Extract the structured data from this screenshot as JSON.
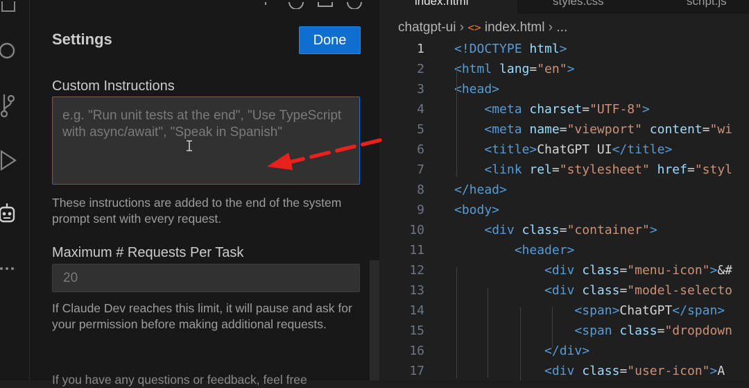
{
  "settings": {
    "title": "Settings",
    "done_label": "Done",
    "custom_instructions": {
      "label": "Custom Instructions",
      "placeholder": "e.g. \"Run unit tests at the end\", \"Use TypeScript with async/await\", \"Speak in Spanish\"",
      "help": "These instructions are added to the end of the system prompt sent with every request."
    },
    "max_requests": {
      "label": "Maximum # Requests Per Task",
      "placeholder": "20",
      "help": "If Claude Dev reaches this limit, it will pause and ask for your permission before making additional requests."
    },
    "footer_text": "If you have any questions or feedback, feel free"
  },
  "editor": {
    "tabs": [
      "index.html",
      "styles.css",
      "script.js"
    ],
    "breadcrumb": {
      "folder": "chatgpt-ui",
      "file": "index.html",
      "more": "..."
    },
    "active_line": 1,
    "lines": [
      {
        "n": "1",
        "tokens": [
          [
            "t-tag",
            "<!DOCTYPE"
          ],
          [
            "t-attr",
            " html"
          ],
          [
            "t-tag",
            ">"
          ]
        ]
      },
      {
        "n": "2",
        "tokens": [
          [
            "t-tag",
            "<html"
          ],
          [
            "t-attr",
            " lang"
          ],
          [
            "t-txt",
            "="
          ],
          [
            "t-str",
            "\"en\""
          ],
          [
            "t-tag",
            ">"
          ]
        ]
      },
      {
        "n": "3",
        "tokens": [
          [
            "t-tag",
            "<head>"
          ]
        ]
      },
      {
        "n": "4",
        "tokens": [
          [
            "t-txt",
            "    "
          ],
          [
            "t-tag",
            "<meta"
          ],
          [
            "t-attr",
            " charset"
          ],
          [
            "t-txt",
            "="
          ],
          [
            "t-str",
            "\"UTF-8\""
          ],
          [
            "t-tag",
            ">"
          ]
        ]
      },
      {
        "n": "5",
        "tokens": [
          [
            "t-txt",
            "    "
          ],
          [
            "t-tag",
            "<meta"
          ],
          [
            "t-attr",
            " name"
          ],
          [
            "t-txt",
            "="
          ],
          [
            "t-str",
            "\"viewport\""
          ],
          [
            "t-attr",
            " content"
          ],
          [
            "t-txt",
            "="
          ],
          [
            "t-str",
            "\"wi"
          ]
        ]
      },
      {
        "n": "6",
        "tokens": [
          [
            "t-txt",
            "    "
          ],
          [
            "t-tag",
            "<title>"
          ],
          [
            "t-txt",
            "ChatGPT UI"
          ],
          [
            "t-tag",
            "</title>"
          ]
        ]
      },
      {
        "n": "7",
        "tokens": [
          [
            "t-txt",
            "    "
          ],
          [
            "t-tag",
            "<link"
          ],
          [
            "t-attr",
            " rel"
          ],
          [
            "t-txt",
            "="
          ],
          [
            "t-str",
            "\"stylesheet\""
          ],
          [
            "t-attr",
            " href"
          ],
          [
            "t-txt",
            "="
          ],
          [
            "t-str",
            "\"styl"
          ]
        ]
      },
      {
        "n": "8",
        "tokens": [
          [
            "t-tag",
            "</head>"
          ]
        ]
      },
      {
        "n": "9",
        "tokens": [
          [
            "t-tag",
            "<body>"
          ]
        ]
      },
      {
        "n": "10",
        "tokens": [
          [
            "t-txt",
            "    "
          ],
          [
            "t-tag",
            "<div"
          ],
          [
            "t-attr",
            " class"
          ],
          [
            "t-txt",
            "="
          ],
          [
            "t-str",
            "\"container\""
          ],
          [
            "t-tag",
            ">"
          ]
        ]
      },
      {
        "n": "11",
        "tokens": [
          [
            "t-txt",
            "        "
          ],
          [
            "t-tag",
            "<header>"
          ]
        ]
      },
      {
        "n": "12",
        "tokens": [
          [
            "t-txt",
            "            "
          ],
          [
            "t-tag",
            "<div"
          ],
          [
            "t-attr",
            " class"
          ],
          [
            "t-txt",
            "="
          ],
          [
            "t-str",
            "\"menu-icon\""
          ],
          [
            "t-tag",
            ">"
          ],
          [
            "t-txt",
            "&#"
          ]
        ]
      },
      {
        "n": "13",
        "tokens": [
          [
            "t-txt",
            "            "
          ],
          [
            "t-tag",
            "<div"
          ],
          [
            "t-attr",
            " class"
          ],
          [
            "t-txt",
            "="
          ],
          [
            "t-str",
            "\"model-selecto"
          ]
        ]
      },
      {
        "n": "14",
        "tokens": [
          [
            "t-txt",
            "                "
          ],
          [
            "t-tag",
            "<span>"
          ],
          [
            "t-txt",
            "ChatGPT"
          ],
          [
            "t-tag",
            "</span>"
          ]
        ]
      },
      {
        "n": "15",
        "tokens": [
          [
            "t-txt",
            "                "
          ],
          [
            "t-tag",
            "<span"
          ],
          [
            "t-attr",
            " class"
          ],
          [
            "t-txt",
            "="
          ],
          [
            "t-str",
            "\"dropdown"
          ]
        ]
      },
      {
        "n": "16",
        "tokens": [
          [
            "t-txt",
            "            "
          ],
          [
            "t-tag",
            "</div>"
          ]
        ]
      },
      {
        "n": "17",
        "tokens": [
          [
            "t-txt",
            "            "
          ],
          [
            "t-tag",
            "<div"
          ],
          [
            "t-attr",
            " class"
          ],
          [
            "t-txt",
            "="
          ],
          [
            "t-str",
            "\"user-icon\""
          ],
          [
            "t-tag",
            ">"
          ],
          [
            "t-txt",
            "A"
          ]
        ]
      }
    ]
  },
  "icons": {
    "activity": [
      "explorer-icon",
      "search-icon",
      "source-control-icon",
      "run-debug-icon",
      "claude-dev-robot-icon",
      "more-icon"
    ],
    "annotation": "red-dashed-arrow"
  },
  "colors": {
    "accent": "#0e6fd0",
    "annotation_red": "#e8211c"
  }
}
